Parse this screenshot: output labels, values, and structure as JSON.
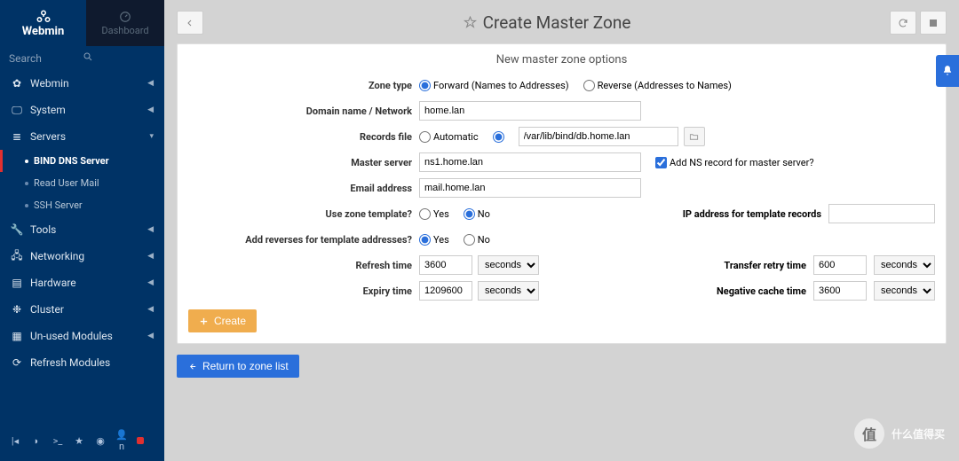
{
  "brand": "Webmin",
  "dashboard_tab": "Dashboard",
  "search_placeholder": "Search",
  "menu": {
    "webmin": "Webmin",
    "system": "System",
    "servers": "Servers",
    "servers_sub": {
      "bind": "BIND DNS Server",
      "mail": "Read User Mail",
      "ssh": "SSH Server"
    },
    "tools": "Tools",
    "networking": "Networking",
    "hardware": "Hardware",
    "cluster": "Cluster",
    "unused": "Un-used Modules",
    "refresh": "Refresh Modules"
  },
  "footer_user": "n",
  "page_title": "Create Master Zone",
  "panel_heading": "New master zone options",
  "labels": {
    "zone_type": "Zone type",
    "domain": "Domain name / Network",
    "records_file": "Records file",
    "master_server": "Master server",
    "email": "Email address",
    "use_template": "Use zone template?",
    "ip_template": "IP address for template records",
    "add_reverses": "Add reverses for template addresses?",
    "refresh_time": "Refresh time",
    "transfer_retry": "Transfer retry time",
    "expiry_time": "Expiry time",
    "negative_cache": "Negative cache time",
    "add_ns": "Add NS record for master server?"
  },
  "opts": {
    "forward": "Forward (Names to Addresses)",
    "reverse": "Reverse (Addresses to Names)",
    "automatic": "Automatic",
    "yes": "Yes",
    "no": "No",
    "seconds": "seconds"
  },
  "values": {
    "domain": "home.lan",
    "records_file": "/var/lib/bind/db.home.lan",
    "master_server": "ns1.home.lan",
    "email": "mail.home.lan",
    "refresh": "3600",
    "retry": "600",
    "expiry": "1209600",
    "negative": "3600"
  },
  "buttons": {
    "create": "Create",
    "return": "Return to zone list"
  },
  "watermark": "什么值得买"
}
